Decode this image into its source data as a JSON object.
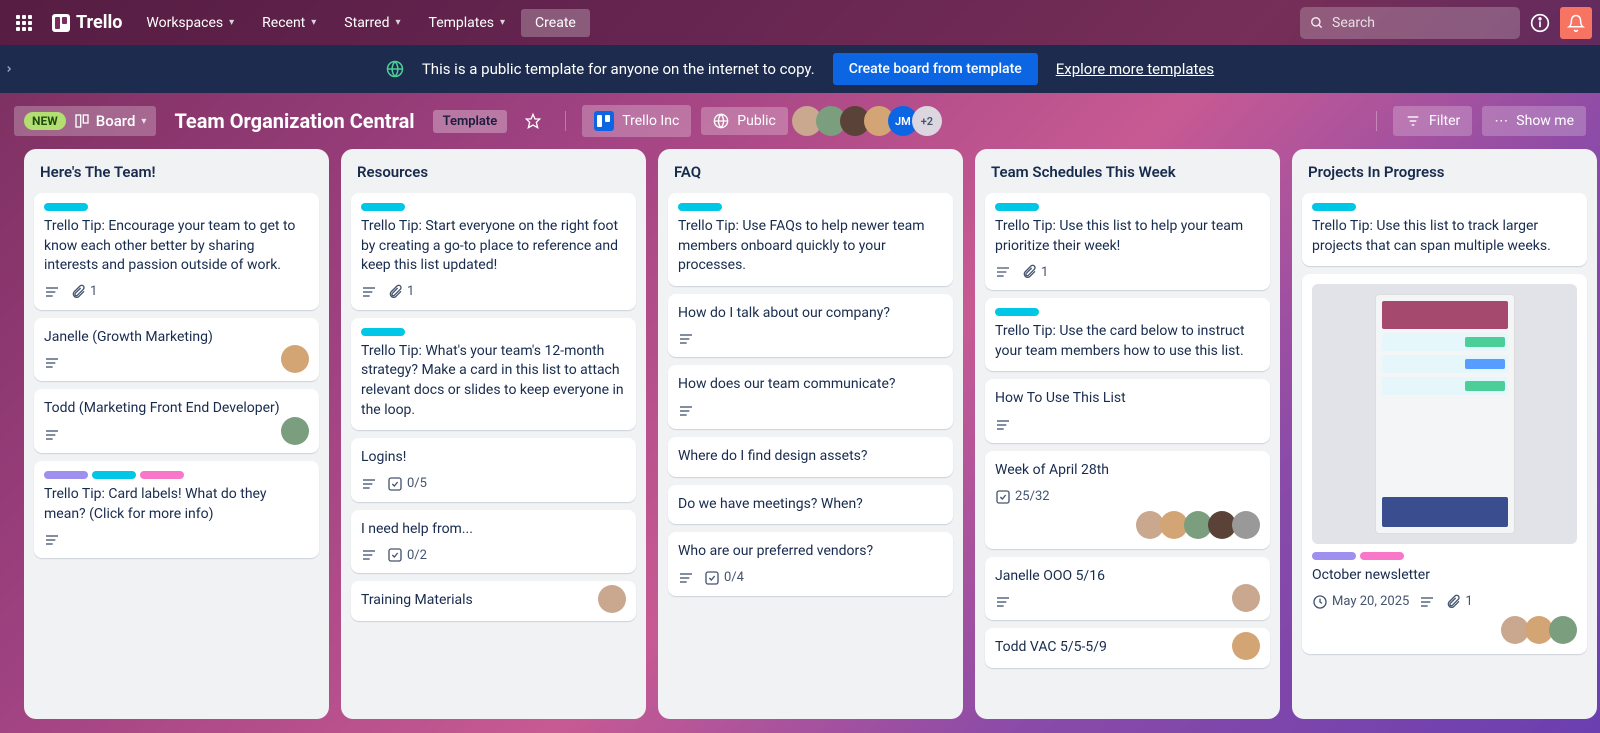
{
  "topbar": {
    "logo": "Trello",
    "nav": [
      "Workspaces",
      "Recent",
      "Starred",
      "Templates"
    ],
    "create": "Create",
    "search_placeholder": "Search"
  },
  "banner": {
    "text": "This is a public template for anyone on the internet to copy.",
    "cta": "Create board from template",
    "link": "Explore more templates"
  },
  "boardbar": {
    "new_badge": "NEW",
    "view": "Board",
    "title": "Team Organization Central",
    "template": "Template",
    "workspace": "Trello Inc",
    "visibility": "Public",
    "avatar_overflow": "+2",
    "filter": "Filter",
    "show_me": "Show me"
  },
  "lists": [
    {
      "title": "Here's The Team!",
      "cards": [
        {
          "labels": [
            "teal"
          ],
          "text": "Trello Tip: Encourage your team to get to know each other better by sharing interests and passion outside of work.",
          "desc": true,
          "attach": "1"
        },
        {
          "text": "Janelle (Growth Marketing)",
          "desc": true,
          "avatar": true
        },
        {
          "text": "Todd (Marketing Front End Developer)",
          "desc": true,
          "avatar": true
        },
        {
          "labels": [
            "purple",
            "teal",
            "pink"
          ],
          "text": "Trello Tip: Card labels! What do they mean? (Click for more info)",
          "desc": true
        }
      ]
    },
    {
      "title": "Resources",
      "cards": [
        {
          "labels": [
            "teal"
          ],
          "text": "Trello Tip: Start everyone on the right foot by creating a go-to place to reference and keep this list updated!",
          "desc": true,
          "attach": "1"
        },
        {
          "labels": [
            "teal"
          ],
          "text": "Trello Tip: What's your team's 12-month strategy? Make a card in this list to attach relevant docs or slides to keep everyone in the loop."
        },
        {
          "text": "Logins!",
          "desc": true,
          "check": "0/5"
        },
        {
          "text": "I need help from...",
          "desc": true,
          "check": "0/2"
        },
        {
          "text": "Training Materials",
          "avatar": true
        }
      ]
    },
    {
      "title": "FAQ",
      "cards": [
        {
          "labels": [
            "teal"
          ],
          "text": "Trello Tip: Use FAQs to help newer team members onboard quickly to your processes."
        },
        {
          "text": "How do I talk about our company?",
          "desc": true
        },
        {
          "text": "How does our team communicate?",
          "desc": true
        },
        {
          "text": "Where do I find design assets?"
        },
        {
          "text": "Do we have meetings? When?"
        },
        {
          "text": "Who are our preferred vendors?",
          "desc": true,
          "check": "0/4"
        }
      ]
    },
    {
      "title": "Team Schedules This Week",
      "cards": [
        {
          "labels": [
            "teal"
          ],
          "text": "Trello Tip: Use this list to help your team prioritize their week!",
          "desc": true,
          "attach": "1"
        },
        {
          "labels": [
            "teal"
          ],
          "text": "Trello Tip: Use the card below to instruct your team members how to use this list."
        },
        {
          "text": "How To Use This List",
          "desc": true
        },
        {
          "text": "Week of April 28th",
          "check": "25/32",
          "avatars_row": 5
        },
        {
          "text": "Janelle OOO 5/16",
          "desc": true,
          "avatar": true
        },
        {
          "text": "Todd VAC 5/5-5/9",
          "avatar": true
        }
      ]
    },
    {
      "title": "Projects In Progress",
      "cards": [
        {
          "labels": [
            "teal"
          ],
          "text": "Trello Tip: Use this list to track larger projects that can span multiple weeks."
        },
        {
          "cover": true,
          "labels": [
            "purple",
            "pink"
          ],
          "text": "October newsletter",
          "date": "May 20, 2025",
          "desc": true,
          "attach": "1",
          "avatars_row": 3
        }
      ]
    }
  ]
}
